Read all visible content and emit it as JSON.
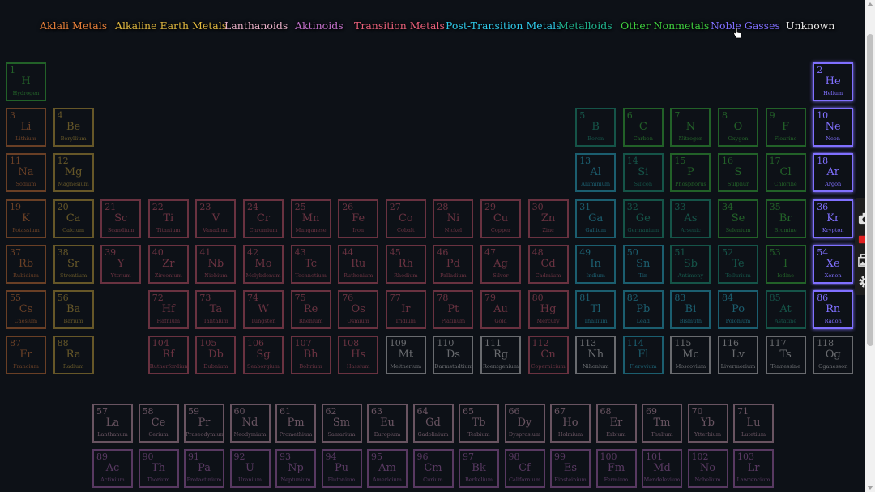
{
  "legend": [
    {
      "key": "alkali",
      "label": "Aklali Metals",
      "color": "#e8803a"
    },
    {
      "key": "alkaline",
      "label": "Alkaline Earth Metals",
      "color": "#e0b840"
    },
    {
      "key": "lanth",
      "label": "Lanthanoids",
      "color": "#e8b0c8"
    },
    {
      "key": "actin",
      "label": "Aktinoids",
      "color": "#c070c8"
    },
    {
      "key": "trans",
      "label": "Transition Metals",
      "color": "#e8607a"
    },
    {
      "key": "post",
      "label": "Post-Transition Metals",
      "color": "#30c8e8"
    },
    {
      "key": "metalloid",
      "label": "Metalloids",
      "color": "#20b08c"
    },
    {
      "key": "nonmetal",
      "label": "Other Nonmetals",
      "color": "#40d040"
    },
    {
      "key": "noble",
      "label": "Noble Gasses",
      "color": "#8070ff"
    },
    {
      "key": "unknown",
      "label": "Unknown",
      "color": "#e8e8e8"
    }
  ],
  "highlight": "noble",
  "elements": [
    {
      "n": 1,
      "s": "H",
      "name": "Hydrogen",
      "c": "nonmetal",
      "r": 0,
      "col": 0
    },
    {
      "n": 2,
      "s": "He",
      "name": "Helium",
      "c": "noble",
      "r": 0,
      "col": 17
    },
    {
      "n": 3,
      "s": "Li",
      "name": "Lithium",
      "c": "alkali",
      "r": 1,
      "col": 0
    },
    {
      "n": 4,
      "s": "Be",
      "name": "Beryllium",
      "c": "alkaline",
      "r": 1,
      "col": 1
    },
    {
      "n": 5,
      "s": "B",
      "name": "Boron",
      "c": "metalloid",
      "r": 1,
      "col": 12
    },
    {
      "n": 6,
      "s": "C",
      "name": "Carbon",
      "c": "nonmetal",
      "r": 1,
      "col": 13
    },
    {
      "n": 7,
      "s": "N",
      "name": "Nitrogen",
      "c": "nonmetal",
      "r": 1,
      "col": 14
    },
    {
      "n": 8,
      "s": "O",
      "name": "Oxygen",
      "c": "nonmetal",
      "r": 1,
      "col": 15
    },
    {
      "n": 9,
      "s": "F",
      "name": "Flourine",
      "c": "nonmetal",
      "r": 1,
      "col": 16
    },
    {
      "n": 10,
      "s": "Ne",
      "name": "Neon",
      "c": "noble",
      "r": 1,
      "col": 17
    },
    {
      "n": 11,
      "s": "Na",
      "name": "Sodium",
      "c": "alkali",
      "r": 2,
      "col": 0
    },
    {
      "n": 12,
      "s": "Mg",
      "name": "Magnesium",
      "c": "alkaline",
      "r": 2,
      "col": 1
    },
    {
      "n": 13,
      "s": "Al",
      "name": "Aluminium",
      "c": "post",
      "r": 2,
      "col": 12
    },
    {
      "n": 14,
      "s": "Si",
      "name": "Silicon",
      "c": "metalloid",
      "r": 2,
      "col": 13
    },
    {
      "n": 15,
      "s": "P",
      "name": "Phosphorus",
      "c": "nonmetal",
      "r": 2,
      "col": 14
    },
    {
      "n": 16,
      "s": "S",
      "name": "Sulphur",
      "c": "nonmetal",
      "r": 2,
      "col": 15
    },
    {
      "n": 17,
      "s": "Cl",
      "name": "Chlorine",
      "c": "nonmetal",
      "r": 2,
      "col": 16
    },
    {
      "n": 18,
      "s": "Ar",
      "name": "Argon",
      "c": "noble",
      "r": 2,
      "col": 17
    },
    {
      "n": 19,
      "s": "K",
      "name": "Potassium",
      "c": "alkali",
      "r": 3,
      "col": 0
    },
    {
      "n": 20,
      "s": "Ca",
      "name": "Calcium",
      "c": "alkaline",
      "r": 3,
      "col": 1
    },
    {
      "n": 21,
      "s": "Sc",
      "name": "Scandium",
      "c": "trans",
      "r": 3,
      "col": 2
    },
    {
      "n": 22,
      "s": "Ti",
      "name": "Titanium",
      "c": "trans",
      "r": 3,
      "col": 3
    },
    {
      "n": 23,
      "s": "V",
      "name": "Vanadium",
      "c": "trans",
      "r": 3,
      "col": 4
    },
    {
      "n": 24,
      "s": "Cr",
      "name": "Chromium",
      "c": "trans",
      "r": 3,
      "col": 5
    },
    {
      "n": 25,
      "s": "Mn",
      "name": "Manganese",
      "c": "trans",
      "r": 3,
      "col": 6
    },
    {
      "n": 26,
      "s": "Fe",
      "name": "Iron",
      "c": "trans",
      "r": 3,
      "col": 7
    },
    {
      "n": 27,
      "s": "Co",
      "name": "Cobalt",
      "c": "trans",
      "r": 3,
      "col": 8
    },
    {
      "n": 28,
      "s": "Ni",
      "name": "Nickel",
      "c": "trans",
      "r": 3,
      "col": 9
    },
    {
      "n": 29,
      "s": "Cu",
      "name": "Copper",
      "c": "trans",
      "r": 3,
      "col": 10
    },
    {
      "n": 30,
      "s": "Zn",
      "name": "Zinc",
      "c": "trans",
      "r": 3,
      "col": 11
    },
    {
      "n": 31,
      "s": "Ga",
      "name": "Gallium",
      "c": "post",
      "r": 3,
      "col": 12
    },
    {
      "n": 32,
      "s": "Ge",
      "name": "Germanium",
      "c": "metalloid",
      "r": 3,
      "col": 13
    },
    {
      "n": 33,
      "s": "As",
      "name": "Arsenic",
      "c": "metalloid",
      "r": 3,
      "col": 14
    },
    {
      "n": 34,
      "s": "Se",
      "name": "Selenium",
      "c": "nonmetal",
      "r": 3,
      "col": 15
    },
    {
      "n": 35,
      "s": "Br",
      "name": "Bromine",
      "c": "nonmetal",
      "r": 3,
      "col": 16
    },
    {
      "n": 36,
      "s": "Kr",
      "name": "Krypton",
      "c": "noble",
      "r": 3,
      "col": 17
    },
    {
      "n": 37,
      "s": "Rb",
      "name": "Rubidium",
      "c": "alkali",
      "r": 4,
      "col": 0
    },
    {
      "n": 38,
      "s": "Sr",
      "name": "Strontium",
      "c": "alkaline",
      "r": 4,
      "col": 1
    },
    {
      "n": 39,
      "s": "Y",
      "name": "Yttrium",
      "c": "trans",
      "r": 4,
      "col": 2
    },
    {
      "n": 40,
      "s": "Zr",
      "name": "Zirconium",
      "c": "trans",
      "r": 4,
      "col": 3
    },
    {
      "n": 41,
      "s": "Nb",
      "name": "Niobium",
      "c": "trans",
      "r": 4,
      "col": 4
    },
    {
      "n": 42,
      "s": "Mo",
      "name": "Molybdenum",
      "c": "trans",
      "r": 4,
      "col": 5
    },
    {
      "n": 43,
      "s": "Tc",
      "name": "Technetium",
      "c": "trans",
      "r": 4,
      "col": 6
    },
    {
      "n": 44,
      "s": "Ru",
      "name": "Ruthenium",
      "c": "trans",
      "r": 4,
      "col": 7
    },
    {
      "n": 45,
      "s": "Rh",
      "name": "Rhodium",
      "c": "trans",
      "r": 4,
      "col": 8
    },
    {
      "n": 46,
      "s": "Pd",
      "name": "Palladium",
      "c": "trans",
      "r": 4,
      "col": 9
    },
    {
      "n": 47,
      "s": "Ag",
      "name": "Silver",
      "c": "trans",
      "r": 4,
      "col": 10
    },
    {
      "n": 48,
      "s": "Cd",
      "name": "Cadmium",
      "c": "trans",
      "r": 4,
      "col": 11
    },
    {
      "n": 49,
      "s": "In",
      "name": "Indium",
      "c": "post",
      "r": 4,
      "col": 12
    },
    {
      "n": 50,
      "s": "Sn",
      "name": "Tin",
      "c": "post",
      "r": 4,
      "col": 13
    },
    {
      "n": 51,
      "s": "Sb",
      "name": "Antimony",
      "c": "metalloid",
      "r": 4,
      "col": 14
    },
    {
      "n": 52,
      "s": "Te",
      "name": "Tellurium",
      "c": "metalloid",
      "r": 4,
      "col": 15
    },
    {
      "n": 53,
      "s": "I",
      "name": "Iodine",
      "c": "nonmetal",
      "r": 4,
      "col": 16
    },
    {
      "n": 54,
      "s": "Xe",
      "name": "Xenon",
      "c": "noble",
      "r": 4,
      "col": 17
    },
    {
      "n": 55,
      "s": "Cs",
      "name": "Caesium",
      "c": "alkali",
      "r": 5,
      "col": 0
    },
    {
      "n": 56,
      "s": "Ba",
      "name": "Barium",
      "c": "alkaline",
      "r": 5,
      "col": 1
    },
    {
      "n": 72,
      "s": "Hf",
      "name": "Hafnium",
      "c": "trans",
      "r": 5,
      "col": 3
    },
    {
      "n": 73,
      "s": "Ta",
      "name": "Tantalum",
      "c": "trans",
      "r": 5,
      "col": 4
    },
    {
      "n": 74,
      "s": "W",
      "name": "Tungsten",
      "c": "trans",
      "r": 5,
      "col": 5
    },
    {
      "n": 75,
      "s": "Re",
      "name": "Rhenium",
      "c": "trans",
      "r": 5,
      "col": 6
    },
    {
      "n": 76,
      "s": "Os",
      "name": "Osmium",
      "c": "trans",
      "r": 5,
      "col": 7
    },
    {
      "n": 77,
      "s": "Ir",
      "name": "Iridium",
      "c": "trans",
      "r": 5,
      "col": 8
    },
    {
      "n": 78,
      "s": "Pt",
      "name": "Platinum",
      "c": "trans",
      "r": 5,
      "col": 9
    },
    {
      "n": 79,
      "s": "Au",
      "name": "Gold",
      "c": "trans",
      "r": 5,
      "col": 10
    },
    {
      "n": 80,
      "s": "Hg",
      "name": "Mercury",
      "c": "trans",
      "r": 5,
      "col": 11
    },
    {
      "n": 81,
      "s": "Tl",
      "name": "Thallium",
      "c": "post",
      "r": 5,
      "col": 12
    },
    {
      "n": 82,
      "s": "Pb",
      "name": "Lead",
      "c": "post",
      "r": 5,
      "col": 13
    },
    {
      "n": 83,
      "s": "Bi",
      "name": "Bismuth",
      "c": "post",
      "r": 5,
      "col": 14
    },
    {
      "n": 84,
      "s": "Po",
      "name": "Polonium",
      "c": "post",
      "r": 5,
      "col": 15
    },
    {
      "n": 85,
      "s": "At",
      "name": "Astatine",
      "c": "metalloid",
      "r": 5,
      "col": 16
    },
    {
      "n": 86,
      "s": "Rn",
      "name": "Radon",
      "c": "noble",
      "r": 5,
      "col": 17
    },
    {
      "n": 87,
      "s": "Fr",
      "name": "Francium",
      "c": "alkali",
      "r": 6,
      "col": 0
    },
    {
      "n": 88,
      "s": "Ra",
      "name": "Radium",
      "c": "alkaline",
      "r": 6,
      "col": 1
    },
    {
      "n": 104,
      "s": "Rf",
      "name": "Rutherfordium",
      "c": "trans",
      "r": 6,
      "col": 3
    },
    {
      "n": 105,
      "s": "Db",
      "name": "Dubnium",
      "c": "trans",
      "r": 6,
      "col": 4
    },
    {
      "n": 106,
      "s": "Sg",
      "name": "Seaborgium",
      "c": "trans",
      "r": 6,
      "col": 5
    },
    {
      "n": 107,
      "s": "Bh",
      "name": "Bohrium",
      "c": "trans",
      "r": 6,
      "col": 6
    },
    {
      "n": 108,
      "s": "Hs",
      "name": "Hassium",
      "c": "trans",
      "r": 6,
      "col": 7
    },
    {
      "n": 109,
      "s": "Mt",
      "name": "Meitnerium",
      "c": "unknown",
      "r": 6,
      "col": 8
    },
    {
      "n": 110,
      "s": "Ds",
      "name": "Darmstadtium",
      "c": "unknown",
      "r": 6,
      "col": 9
    },
    {
      "n": 111,
      "s": "Rg",
      "name": "Roentgenium",
      "c": "unknown",
      "r": 6,
      "col": 10
    },
    {
      "n": 112,
      "s": "Cn",
      "name": "Copernicium",
      "c": "trans",
      "r": 6,
      "col": 11
    },
    {
      "n": 113,
      "s": "Nh",
      "name": "Nihonium",
      "c": "unknown",
      "r": 6,
      "col": 12
    },
    {
      "n": 114,
      "s": "Fl",
      "name": "Flerovium",
      "c": "post",
      "r": 6,
      "col": 13
    },
    {
      "n": 115,
      "s": "Mc",
      "name": "Moscovium",
      "c": "unknown",
      "r": 6,
      "col": 14
    },
    {
      "n": 116,
      "s": "Lv",
      "name": "Livermorium",
      "c": "unknown",
      "r": 6,
      "col": 15
    },
    {
      "n": 117,
      "s": "Ts",
      "name": "Tennessine",
      "c": "unknown",
      "r": 6,
      "col": 16
    },
    {
      "n": 118,
      "s": "Og",
      "name": "Oganesson",
      "c": "unknown",
      "r": 6,
      "col": 17
    },
    {
      "n": 57,
      "s": "La",
      "name": "Lanthanum",
      "c": "lanth",
      "r": 8,
      "col": 0
    },
    {
      "n": 58,
      "s": "Ce",
      "name": "Cerium",
      "c": "lanth",
      "r": 8,
      "col": 1
    },
    {
      "n": 59,
      "s": "Pr",
      "name": "Praseodymium",
      "c": "lanth",
      "r": 8,
      "col": 2
    },
    {
      "n": 60,
      "s": "Nd",
      "name": "Neodymium",
      "c": "lanth",
      "r": 8,
      "col": 3
    },
    {
      "n": 61,
      "s": "Pm",
      "name": "Promethium",
      "c": "lanth",
      "r": 8,
      "col": 4
    },
    {
      "n": 62,
      "s": "Sm",
      "name": "Samarium",
      "c": "lanth",
      "r": 8,
      "col": 5
    },
    {
      "n": 63,
      "s": "Eu",
      "name": "Europium",
      "c": "lanth",
      "r": 8,
      "col": 6
    },
    {
      "n": 64,
      "s": "Gd",
      "name": "Gadolinium",
      "c": "lanth",
      "r": 8,
      "col": 7
    },
    {
      "n": 65,
      "s": "Tb",
      "name": "Terbium",
      "c": "lanth",
      "r": 8,
      "col": 8
    },
    {
      "n": 66,
      "s": "Dy",
      "name": "Dysprosium",
      "c": "lanth",
      "r": 8,
      "col": 9
    },
    {
      "n": 67,
      "s": "Ho",
      "name": "Holmium",
      "c": "lanth",
      "r": 8,
      "col": 10
    },
    {
      "n": 68,
      "s": "Er",
      "name": "Erbium",
      "c": "lanth",
      "r": 8,
      "col": 11
    },
    {
      "n": 69,
      "s": "Tm",
      "name": "Thulium",
      "c": "lanth",
      "r": 8,
      "col": 12
    },
    {
      "n": 70,
      "s": "Yb",
      "name": "Ytterbium",
      "c": "lanth",
      "r": 8,
      "col": 13
    },
    {
      "n": 71,
      "s": "Lu",
      "name": "Lutetium",
      "c": "lanth",
      "r": 8,
      "col": 14
    },
    {
      "n": 89,
      "s": "Ac",
      "name": "Actinium",
      "c": "actin",
      "r": 9,
      "col": 0
    },
    {
      "n": 90,
      "s": "Th",
      "name": "Thorium",
      "c": "actin",
      "r": 9,
      "col": 1
    },
    {
      "n": 91,
      "s": "Pa",
      "name": "Protactinium",
      "c": "actin",
      "r": 9,
      "col": 2
    },
    {
      "n": 92,
      "s": "U",
      "name": "Uranium",
      "c": "actin",
      "r": 9,
      "col": 3
    },
    {
      "n": 93,
      "s": "Np",
      "name": "Neptunium",
      "c": "actin",
      "r": 9,
      "col": 4
    },
    {
      "n": 94,
      "s": "Pu",
      "name": "Plutonium",
      "c": "actin",
      "r": 9,
      "col": 5
    },
    {
      "n": 95,
      "s": "Am",
      "name": "Americium",
      "c": "actin",
      "r": 9,
      "col": 6
    },
    {
      "n": 96,
      "s": "Cm",
      "name": "Curium",
      "c": "actin",
      "r": 9,
      "col": 7
    },
    {
      "n": 97,
      "s": "Bk",
      "name": "Berkelium",
      "c": "actin",
      "r": 9,
      "col": 8
    },
    {
      "n": 98,
      "s": "Cf",
      "name": "Californium",
      "c": "actin",
      "r": 9,
      "col": 9
    },
    {
      "n": 99,
      "s": "Es",
      "name": "Einsteinium",
      "c": "actin",
      "r": 9,
      "col": 10
    },
    {
      "n": 100,
      "s": "Fm",
      "name": "Fermium",
      "c": "actin",
      "r": 9,
      "col": 11
    },
    {
      "n": 101,
      "s": "Md",
      "name": "Mendelevium",
      "c": "actin",
      "r": 9,
      "col": 12
    },
    {
      "n": 102,
      "s": "No",
      "name": "Nobelium",
      "c": "actin",
      "r": 9,
      "col": 13
    },
    {
      "n": 103,
      "s": "Lr",
      "name": "Lawrencium",
      "c": "actin",
      "r": 9,
      "col": 14
    }
  ],
  "toolbar": [
    {
      "icon": "camera-icon",
      "color": "#e0e0e0"
    },
    {
      "icon": "video-camera-icon",
      "color": "#e02020"
    },
    {
      "icon": "gallery-icon",
      "color": "#e0e0e0"
    },
    {
      "icon": "gear-icon",
      "color": "#e0e0e0"
    }
  ]
}
